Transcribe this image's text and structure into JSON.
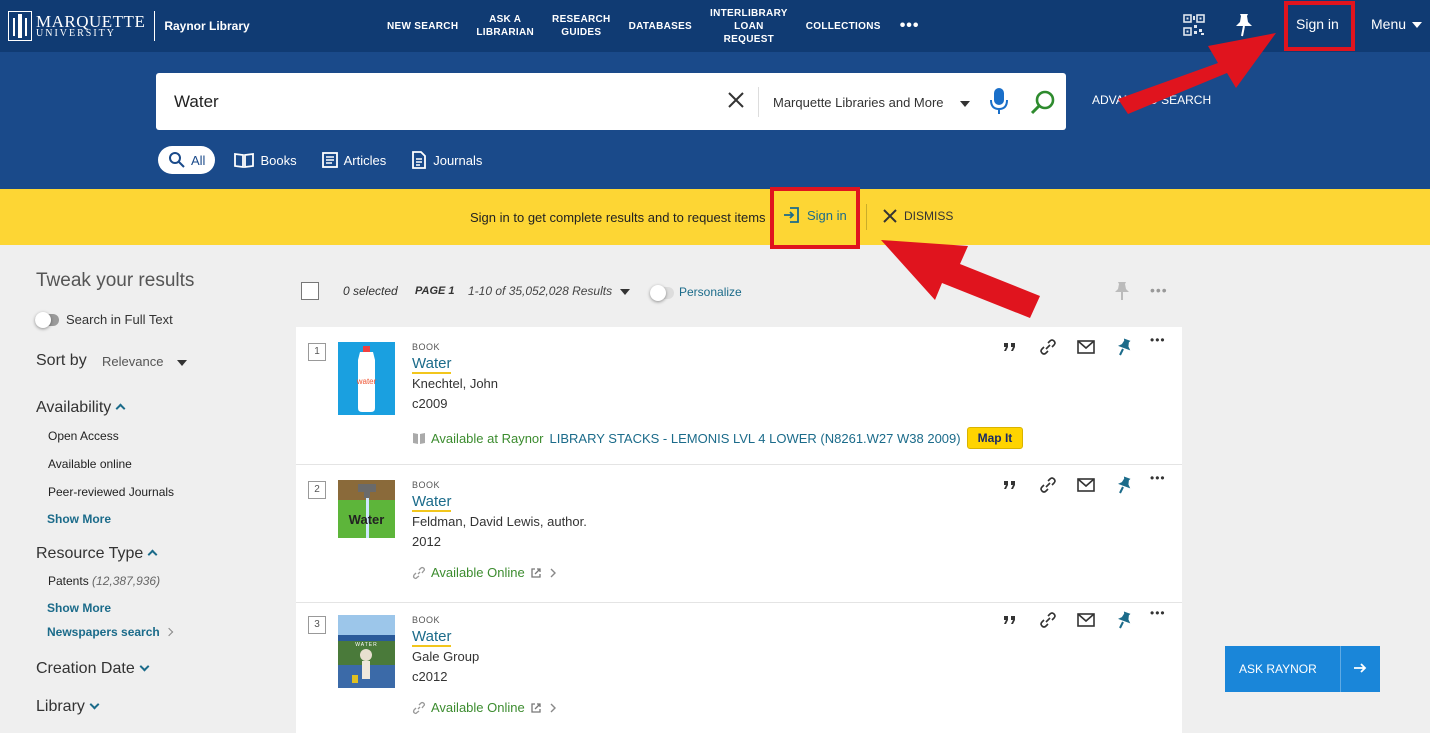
{
  "header": {
    "university": "MARQUETTE",
    "university_sub": "UNIVERSITY",
    "library": "Raynor Library",
    "nav": [
      "NEW SEARCH",
      "ASK A\nLIBRARIAN",
      "RESEARCH\nGUIDES",
      "DATABASES",
      "INTERLIBRARY\nLOAN\nREQUEST",
      "COLLECTIONS"
    ],
    "more": "•••",
    "sign_in": "Sign in",
    "menu": "Menu"
  },
  "search": {
    "query": "Water",
    "scope": "Marquette Libraries and More",
    "advanced": "ADVANCED SEARCH",
    "tabs": [
      "All",
      "Books",
      "Articles",
      "Journals"
    ]
  },
  "banner": {
    "text": "Sign in to get complete results and to request items",
    "sign_in": "Sign in",
    "dismiss": "DISMISS"
  },
  "sidebar": {
    "title": "Tweak your results",
    "full_text": "Search in Full Text",
    "sort_label": "Sort by",
    "sort_value": "Relevance",
    "availability": {
      "heading": "Availability",
      "items": [
        "Open Access",
        "Available online",
        "Peer-reviewed Journals"
      ],
      "show_more": "Show More"
    },
    "resource_type": {
      "heading": "Resource Type",
      "item": "Patents",
      "item_count": "(12,387,936)",
      "show_more": "Show More",
      "newspapers": "Newspapers search"
    },
    "creation_date": "Creation Date",
    "library": "Library"
  },
  "toolbar": {
    "selected": "0 selected",
    "page": "PAGE 1",
    "count": "1-10 of 35,052,028 Results",
    "personalize": "Personalize"
  },
  "results": [
    {
      "num": "1",
      "type": "BOOK",
      "title": "Water",
      "author": "Knechtel, John",
      "date": "c2009",
      "availability": "Available at Raynor",
      "location": "LIBRARY STACKS - LEMONIS LVL 4 LOWER (N8261.W27 W38 2009)",
      "map_it": "Map It",
      "cover_text": "water"
    },
    {
      "num": "2",
      "type": "BOOK",
      "title": "Water",
      "author": "Feldman, David Lewis, author.",
      "date": "2012",
      "availability": "Available Online",
      "cover_text": "Water"
    },
    {
      "num": "3",
      "type": "BOOK",
      "title": "Water",
      "author": "Gale Group",
      "date": "c2012",
      "availability": "Available Online",
      "cover_text": "WATER"
    }
  ],
  "chat": {
    "label": "ASK RAYNOR"
  },
  "colors": {
    "nav": "#103b73",
    "search_band": "#1a4a8a",
    "banner": "#fdd634",
    "link": "#1b6b8a",
    "available": "#3c8c2f",
    "annotation": "#e0141e"
  }
}
